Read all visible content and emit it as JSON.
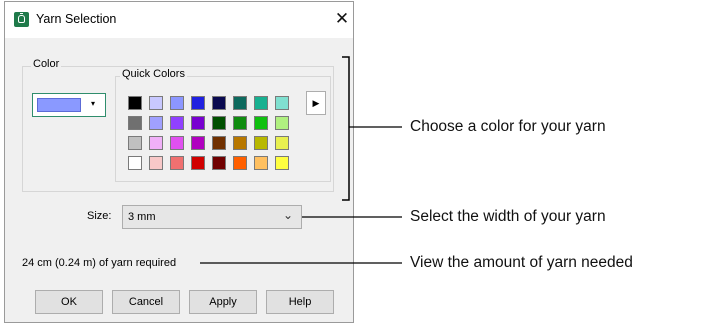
{
  "window": {
    "title": "Yarn Selection",
    "close_glyph": "✕"
  },
  "color_group": {
    "label": "Color",
    "selected_color": "#8a99ff",
    "dropdown_glyph": "▾"
  },
  "quick_colors": {
    "label": "Quick Colors",
    "more_glyph": "▶",
    "rows": [
      [
        "#000000",
        "#c8c8ff",
        "#8c96ff",
        "#2020e0",
        "#0a0a50",
        "#0e6a5e",
        "#18b090",
        "#80e0d0"
      ],
      [
        "#707070",
        "#a0a0ff",
        "#9040ff",
        "#7800d0",
        "#005000",
        "#108c10",
        "#10c010",
        "#b0f080"
      ],
      [
        "#c0c0c0",
        "#f0b0f8",
        "#e050f0",
        "#b000c0",
        "#703000",
        "#b87800",
        "#b8b800",
        "#e8f050"
      ],
      [
        "#ffffff",
        "#f8c8c8",
        "#f07070",
        "#d00000",
        "#700000",
        "#ff6000",
        "#ffc060",
        "#ffff40"
      ]
    ]
  },
  "size": {
    "label": "Size:",
    "value": "3 mm",
    "dropdown_glyph": "⌄"
  },
  "requirement_text": "24 cm (0.24 m) of yarn required",
  "buttons": {
    "ok": "OK",
    "cancel": "Cancel",
    "apply": "Apply",
    "help": "Help"
  },
  "callouts": {
    "color": "Choose a color for your yarn",
    "width": "Select the width of your yarn",
    "amount": "View the amount of yarn needed"
  }
}
